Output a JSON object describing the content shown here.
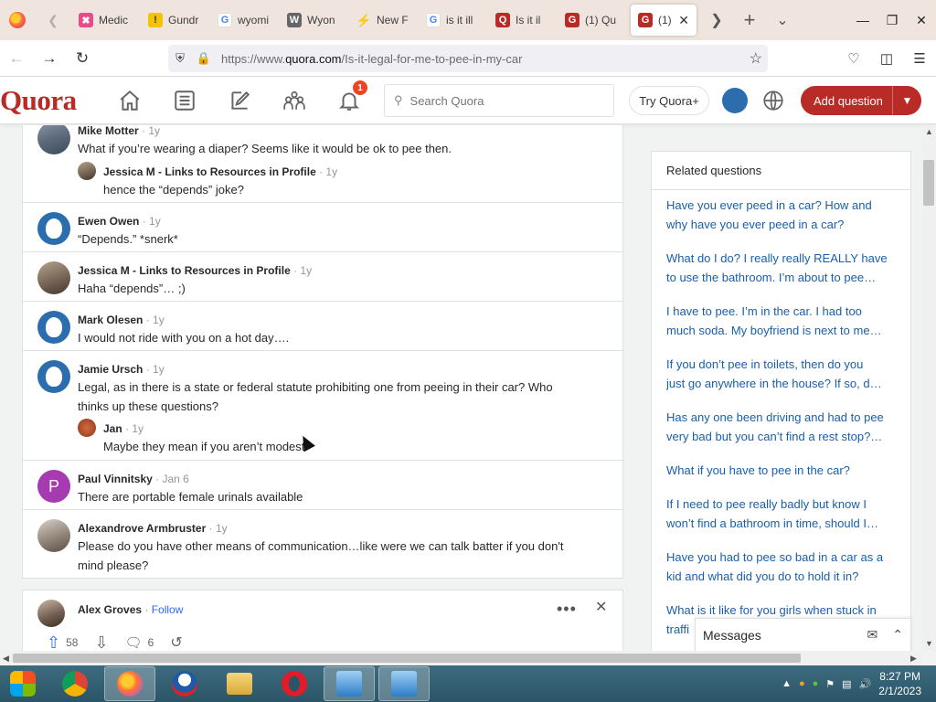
{
  "browser": {
    "tabs": [
      {
        "label": "Medic",
        "icon_color": "#e84b8a",
        "icon_char": "✖"
      },
      {
        "label": "Gundr",
        "icon_color": "#f5c400",
        "icon_char": "!"
      },
      {
        "label": "wyomi",
        "icon_color": "#4285f4",
        "icon_char": "G"
      },
      {
        "label": "Wyon",
        "icon_color": "#666666",
        "icon_char": "W"
      },
      {
        "label": "New F",
        "icon_color": "#f2b400",
        "icon_char": "⚡"
      },
      {
        "label": "is it ill",
        "icon_color": "#4285f4",
        "icon_char": "G"
      },
      {
        "label": "Is it il",
        "icon_color": "#b92b27",
        "icon_char": "Q"
      },
      {
        "label": "(1) Qu",
        "icon_color": "#b92b27",
        "icon_char": "G"
      }
    ],
    "active_tab": {
      "label": "(1)",
      "icon_color": "#b92b27",
      "icon_char": "G",
      "close": "✕"
    },
    "url_prefix": "https://www.",
    "url_domain": "quora.com",
    "url_path": "/Is-it-legal-for-me-to-pee-in-my-car"
  },
  "quora": {
    "logo": "Quora",
    "notification_count": "1",
    "search_placeholder": "Search Quora",
    "try_plus": "Try Quora+",
    "add_question": "Add question"
  },
  "comments": [
    {
      "name": "Mike Motter",
      "meta": " · 1y",
      "text": "What if you’re wearing a diaper? Seems like it would be ok to pee then."
    },
    {
      "name": "Jessica M - Links to Resources in Profile",
      "meta": " · 1y",
      "text": "hence the “depends” joke?"
    },
    {
      "name": "Ewen Owen",
      "meta": " · 1y",
      "text": "“Depends.” *snerk*"
    },
    {
      "name": "Jessica M - Links to Resources in Profile",
      "meta": " · 1y",
      "text": "Haha “depends”… ;)"
    },
    {
      "name": "Mark Olesen",
      "meta": " · 1y",
      "text": "I would not ride with you on a hot day…."
    },
    {
      "name": "Jamie Ursch",
      "meta": " · 1y",
      "text_line1": "Legal, as in there is a state or federal statute prohibiting one from peeing in their car? Who",
      "text_line2": "thinks up these questions?"
    },
    {
      "name": "Jan",
      "meta": " · 1y",
      "text": "Maybe they mean if you aren’t modest"
    },
    {
      "name": "Paul Vinnitsky",
      "meta": " · Jan 6",
      "text": "There are portable female urinals available",
      "initial": "P"
    },
    {
      "name": "Alexandrove Armbruster",
      "meta": " · 1y",
      "text_line1": "Please do you have other means of communication…like were we can talk batter if you don't",
      "text_line2": "mind please?"
    }
  ],
  "next_answer": {
    "name": "Alex Groves",
    "sep": " · ",
    "follow": "Follow",
    "upvotes": "58",
    "comments": "6"
  },
  "related": {
    "title": "Related questions",
    "items": [
      [
        "Have you ever peed in a car? How and",
        "why have you ever peed in a car?"
      ],
      [
        "What do I do? I really really REALLY have",
        "to use the bathroom. I’m about to pee…"
      ],
      [
        "I have to pee. I’m in the car. I had too",
        "much soda. My boyfriend is next to me…"
      ],
      [
        "If you don’t pee in toilets, then do you",
        "just go anywhere in the house? If so, d…"
      ],
      [
        "Has any one been driving and had to pee",
        "very bad but you can’t find a rest stop?…"
      ],
      [
        "What if you have to pee in the car?",
        ""
      ],
      [
        "If I need to pee really badly but know I",
        "won’t find a bathroom in time, should I…"
      ],
      [
        "Have you had to pee so bad in a car as a",
        "kid and what did you do to hold it in?"
      ],
      [
        "What is it like for you girls when stuck in",
        "traffi"
      ]
    ]
  },
  "messages_label": "Messages",
  "taskbar": {
    "time": "8:27 PM",
    "date": "2/1/2023"
  },
  "colors": {
    "brand": "#b92b27",
    "link": "#195faa",
    "meta": "#939598"
  }
}
